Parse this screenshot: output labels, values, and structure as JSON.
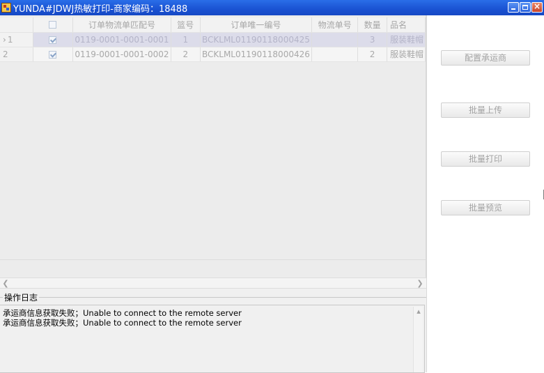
{
  "window": {
    "title": "YUNDA#JDWJ热敏打印-商家编码：18488"
  },
  "grid": {
    "columns": [
      "",
      "订单物流单匹配号",
      "篮号",
      "订单唯一编号",
      "物流单号",
      "数量",
      "品名"
    ],
    "rows": [
      {
        "row_label": "1",
        "checked": true,
        "match_no": "0119-0001-0001-0001",
        "box_no": "1",
        "order_no": "BCKLML01190118000425",
        "logistics_no": "",
        "qty": "3",
        "name": "服装鞋帽"
      },
      {
        "row_label": "2",
        "checked": true,
        "match_no": "0119-0001-0001-0002",
        "box_no": "2",
        "order_no": "BCKLML01190118000426",
        "logistics_no": "",
        "qty": "2",
        "name": "服装鞋帽"
      }
    ]
  },
  "log": {
    "title": "操作日志",
    "lines": [
      "承运商信息获取失败；Unable to connect to the remote server",
      "承运商信息获取失败；Unable to connect to the remote server"
    ]
  },
  "actions": {
    "config_carrier": "配置承运商",
    "batch_upload": "批量上传",
    "batch_print": "批量打印",
    "batch_preview": "批量预览"
  },
  "icons": {
    "app": "app-icon",
    "minimize": "minimize-icon",
    "maximize": "maximize-icon",
    "close": "close-icon",
    "scroll_left": "chevron-left-icon",
    "scroll_right": "chevron-right-icon",
    "scroll_up": "chevron-up-icon"
  },
  "colors": {
    "titlebar": "#1a52d2",
    "selected_row": "#dcdcea"
  }
}
